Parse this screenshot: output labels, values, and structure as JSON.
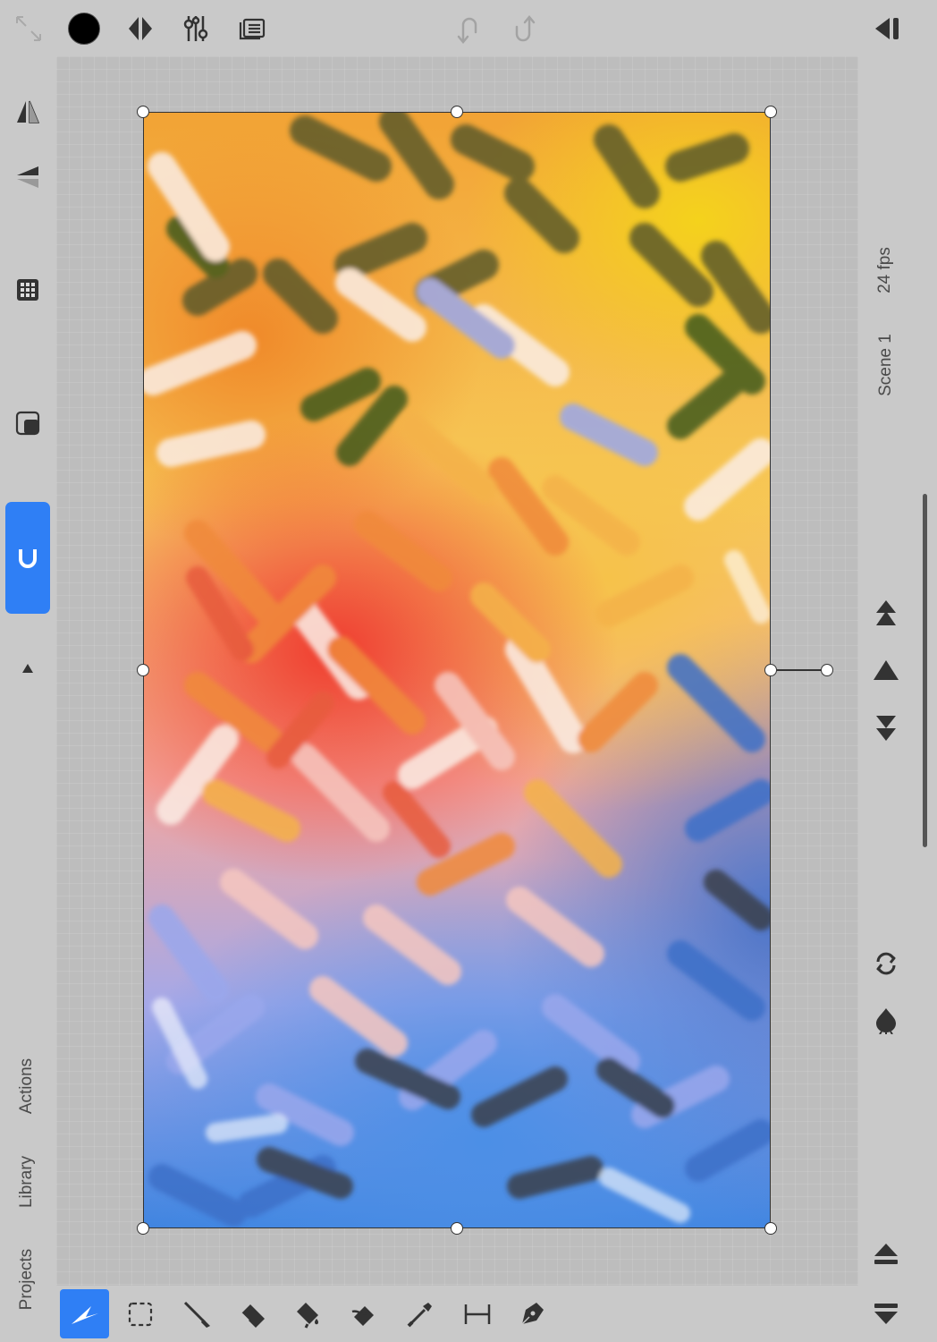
{
  "top_toolbar": {
    "icons": [
      "fullscreen-icon",
      "color-swatch-icon",
      "layers-icon",
      "adjustments-icon",
      "onion-skin-icon",
      "undo-icon",
      "redo-icon",
      "collapse-panel-icon"
    ],
    "current_color": "#000000"
  },
  "left_sidebar": {
    "icons": [
      "flip-horizontal-icon",
      "flip-vertical-icon",
      "grid-icon",
      "clip-layer-icon",
      "magnet-icon",
      "expand-up-icon"
    ],
    "snap_active": true,
    "labels": {
      "actions": "Actions",
      "library": "Library",
      "projects": "Projects"
    }
  },
  "right_sidebar": {
    "fps_label": "24 fps",
    "scene_label": "Scene 1",
    "icons": [
      "jump-to-start-icon",
      "previous-frame-icon",
      "jump-to-end-icon",
      "loop-icon",
      "onion-icon",
      "timeline-up-icon",
      "timeline-down-icon"
    ]
  },
  "bottom_toolbar": {
    "tools": [
      "transform-tool-icon",
      "selection-tool-icon",
      "brush-tool-icon",
      "eraser-tool-icon",
      "fill-tool-icon",
      "smudge-tool-icon",
      "eyedropper-tool-icon",
      "measure-tool-icon",
      "pen-tool-icon"
    ],
    "active_tool": "transform-tool-icon"
  },
  "colors": {
    "accent": "#2f7ff5",
    "panel_bg": "#c9c9c9",
    "stage_bg": "#bdbdbd"
  }
}
